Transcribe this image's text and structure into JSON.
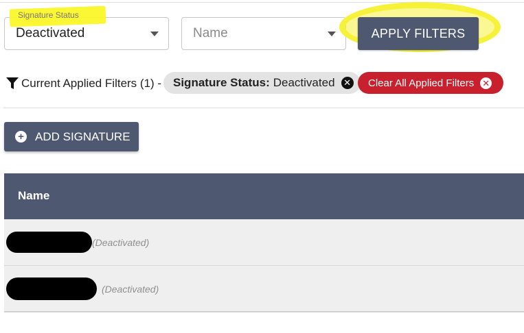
{
  "filters": {
    "signature_status": {
      "label": "Signature Status",
      "value": "Deactivated"
    },
    "name": {
      "placeholder": "Name"
    },
    "apply_label": "APPLY FILTERS"
  },
  "applied": {
    "summary": "Current Applied Filters (1) -",
    "chip_key": "Signature Status:",
    "chip_value": "Deactivated",
    "clear_label": "Clear All Applied Filters"
  },
  "actions": {
    "add_label": "ADD SIGNATURE"
  },
  "table": {
    "headers": [
      "Name"
    ],
    "rows": [
      {
        "name": "[redacted]",
        "status": "(Deactivated)"
      },
      {
        "name": "[redacted]",
        "status": "(Deactivated)"
      }
    ]
  },
  "colors": {
    "primary": "#4e5870",
    "danger": "#c9202e",
    "highlight": "#f6f23a",
    "chip_bg": "#e3e3e3",
    "row_bg": "#efefef"
  },
  "icons": {
    "filter": "funnel-icon",
    "close": "close-circle-icon",
    "add": "plus-circle-icon",
    "dropdown": "caret-down-icon"
  }
}
